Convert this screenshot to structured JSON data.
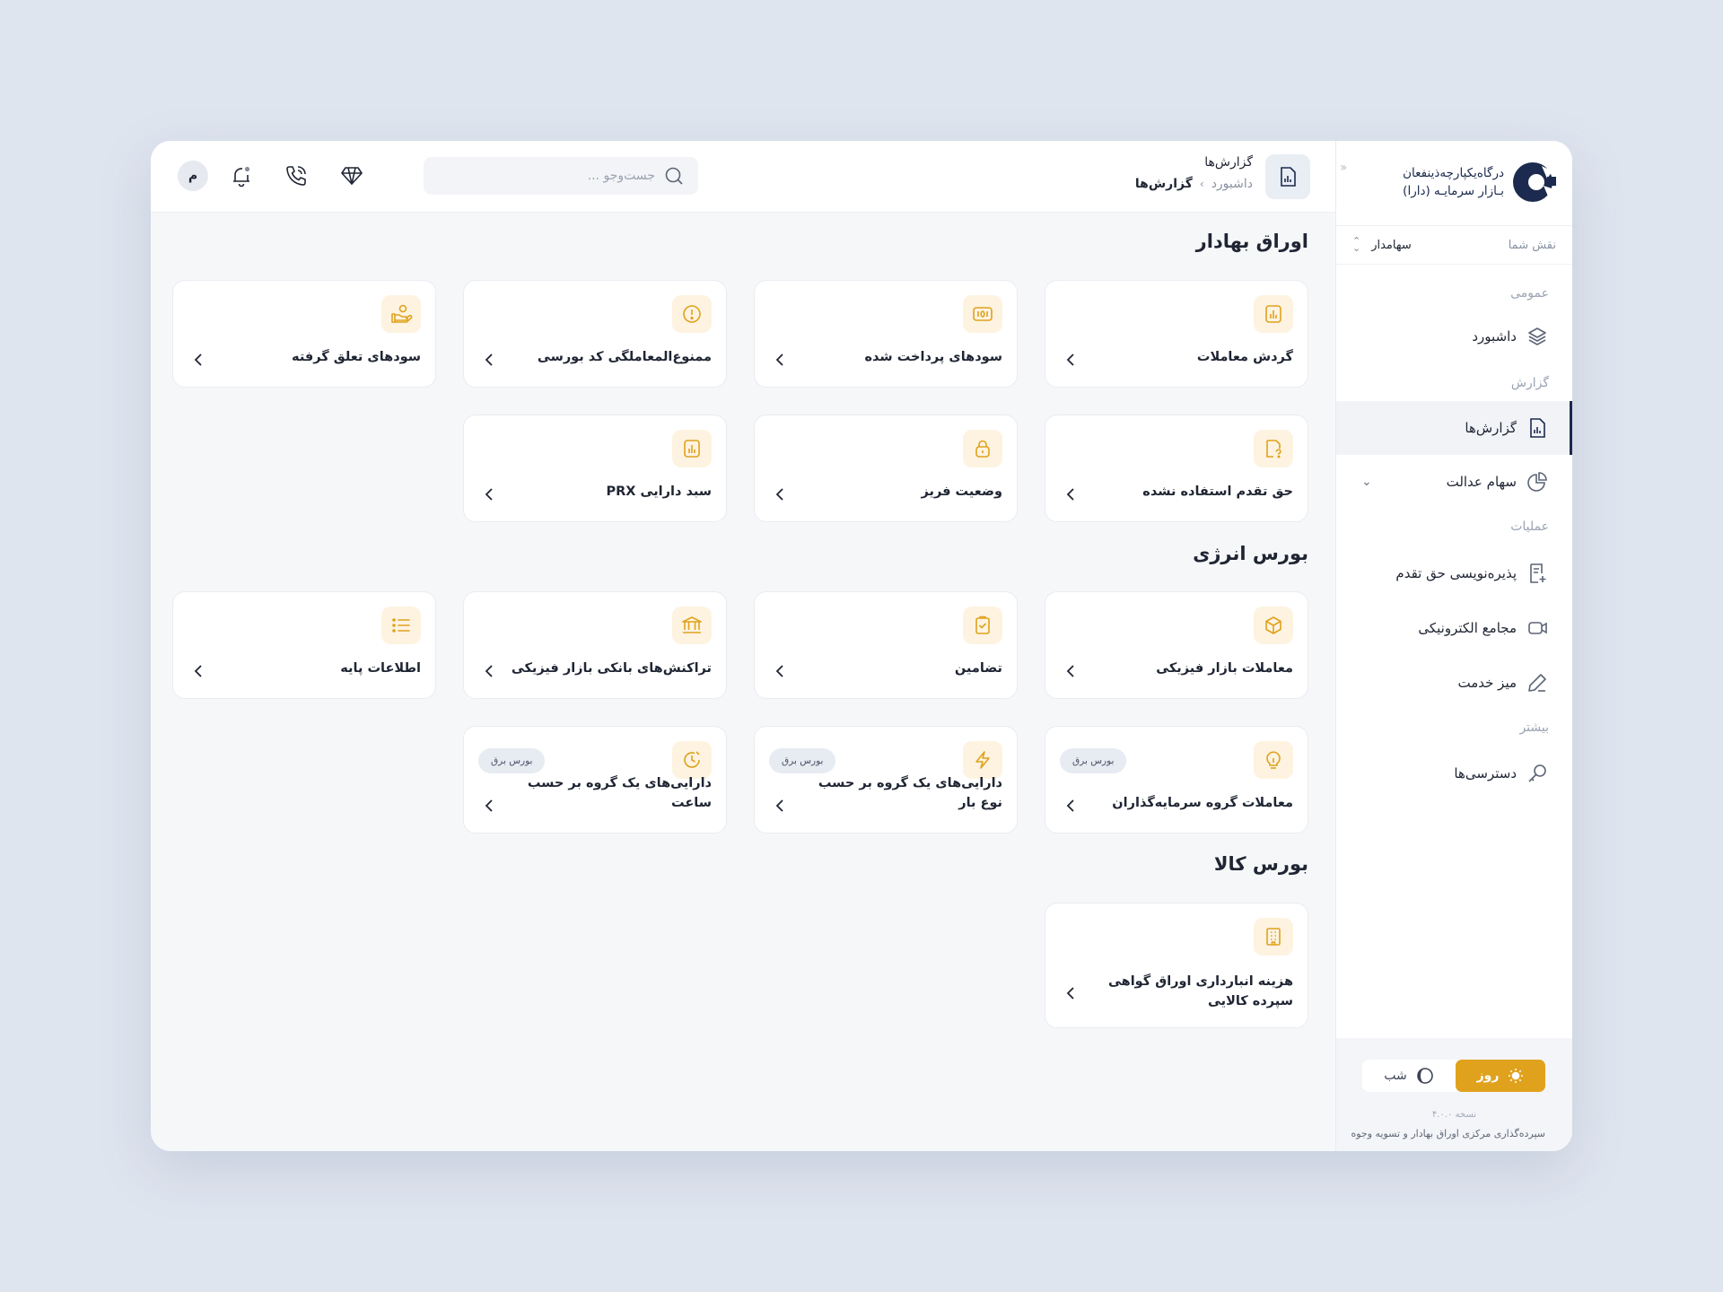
{
  "app": {
    "logo_line1": "درگاه‌یکپارچه‌ذینفعان",
    "logo_line2": "بـازار سرمایـه (دارا)"
  },
  "role": {
    "label": "نقش شما",
    "value": "سهامدار"
  },
  "nav": {
    "section_general": "عمومی",
    "dashboard": "داشبورد",
    "section_report": "گزارش",
    "reports": "گزارش‌ها",
    "justice_shares": "سهام عدالت",
    "section_operations": "عملیات",
    "rights_subscription": "پذیره‌نویسی حق تقدم",
    "e_assemblies": "مجامع الکترونیکی",
    "service_desk": "میز خدمت",
    "section_more": "بیشتر",
    "accesses": "دسترسی‌ها"
  },
  "footer": {
    "day": "روز",
    "night": "شب",
    "version": "نسخه ۴.۰.۰",
    "org": "سپرده‌گذاری مرکزی اوراق بهادار و تسویه وجوه"
  },
  "header": {
    "title": "گزارش‌ها",
    "breadcrumb_parent": "داشبورد",
    "breadcrumb_sep": "›",
    "breadcrumb_current": "گزارش‌ها",
    "search_placeholder": "جست‌وجو ...",
    "avatar_initial": "م"
  },
  "sections": {
    "securities": "اوراق بهادار",
    "energy": "بورس انرژی",
    "commodity": "بورس کالا"
  },
  "cards": {
    "turnover": "گردش معاملات",
    "paid_dividends": "سودهای پرداخت شده",
    "banned_code": "ممنوع‌المعاملگی کد بورسی",
    "accrued_dividends": "سودهای تعلق گرفته",
    "unused_rights": "حق تقدم استفاده نشده",
    "freeze_status": "وضعیت فریز",
    "prx_basket": "سبد دارایی PRX",
    "physical_trades": "معاملات بازار فیزیکی",
    "guarantees": "تضامین",
    "bank_transactions": "تراکنش‌های بانکی بازار فیزیکی",
    "base_info": "اطلاعات پایه",
    "investor_group_trades": "معاملات گروه سرمایه‌گذاران",
    "group_by_load": "دارایی‌های یک گروه بر حسب نوع بار",
    "group_by_hour": "دارایی‌های یک گروه بر حسب ساعت",
    "warehouse_cost": "هزینه انبارداری اوراق گواهی سپرده کالایی",
    "badge": "بورس برق"
  },
  "colors": {
    "accent": "#e0a21d",
    "icon_bg": "#fdf3e0",
    "brand_navy": "#1b2a4e"
  }
}
